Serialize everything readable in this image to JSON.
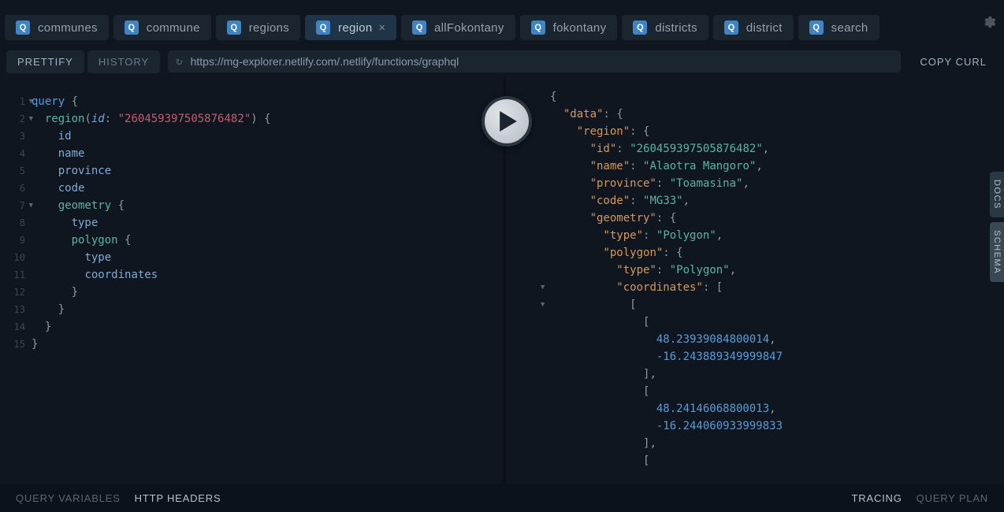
{
  "tabs": [
    {
      "badge": "Q",
      "label": "communes"
    },
    {
      "badge": "Q",
      "label": "commune"
    },
    {
      "badge": "Q",
      "label": "regions"
    },
    {
      "badge": "Q",
      "label": "region",
      "active": true
    },
    {
      "badge": "Q",
      "label": "allFokontany"
    },
    {
      "badge": "Q",
      "label": "fokontany"
    },
    {
      "badge": "Q",
      "label": "districts"
    },
    {
      "badge": "Q",
      "label": "district"
    },
    {
      "badge": "Q",
      "label": "search"
    }
  ],
  "toolbar": {
    "prettify": "PRETTIFY",
    "history": "HISTORY",
    "url": "https://mg-explorer.netlify.com/.netlify/functions/graphql",
    "copy_curl": "COPY CURL"
  },
  "editor": {
    "lines": [
      "1",
      "2",
      "3",
      "4",
      "5",
      "6",
      "7",
      "8",
      "9",
      "10",
      "11",
      "12",
      "13",
      "14",
      "15"
    ],
    "query_kw": "query",
    "region_fn": "region",
    "id_arg": "id",
    "id_val": "\"260459397505876482\"",
    "f_id": "id",
    "f_name": "name",
    "f_province": "province",
    "f_code": "code",
    "f_geometry": "geometry",
    "f_type": "type",
    "f_polygon": "polygon",
    "f_type2": "type",
    "f_coordinates": "coordinates"
  },
  "result": {
    "data": "\"data\"",
    "region": "\"region\"",
    "id_k": "\"id\"",
    "id_v": "\"260459397505876482\"",
    "name_k": "\"name\"",
    "name_v": "\"Alaotra Mangoro\"",
    "province_k": "\"province\"",
    "province_v": "\"Toamasina\"",
    "code_k": "\"code\"",
    "code_v": "\"MG33\"",
    "geometry_k": "\"geometry\"",
    "type_k": "\"type\"",
    "type_v": "\"Polygon\"",
    "polygon_k": "\"polygon\"",
    "type_k2": "\"type\"",
    "type_v2": "\"Polygon\"",
    "coordinates_k": "\"coordinates\"",
    "c1a": "48.23939084800014",
    "c1b": "-16.243889349999847",
    "c2a": "48.24146068800013",
    "c2b": "-16.244060933999833"
  },
  "side": {
    "docs": "DOCS",
    "schema": "SCHEMA"
  },
  "footer": {
    "qvars": "QUERY VARIABLES",
    "headers": "HTTP HEADERS",
    "tracing": "TRACING",
    "qplan": "QUERY PLAN"
  }
}
